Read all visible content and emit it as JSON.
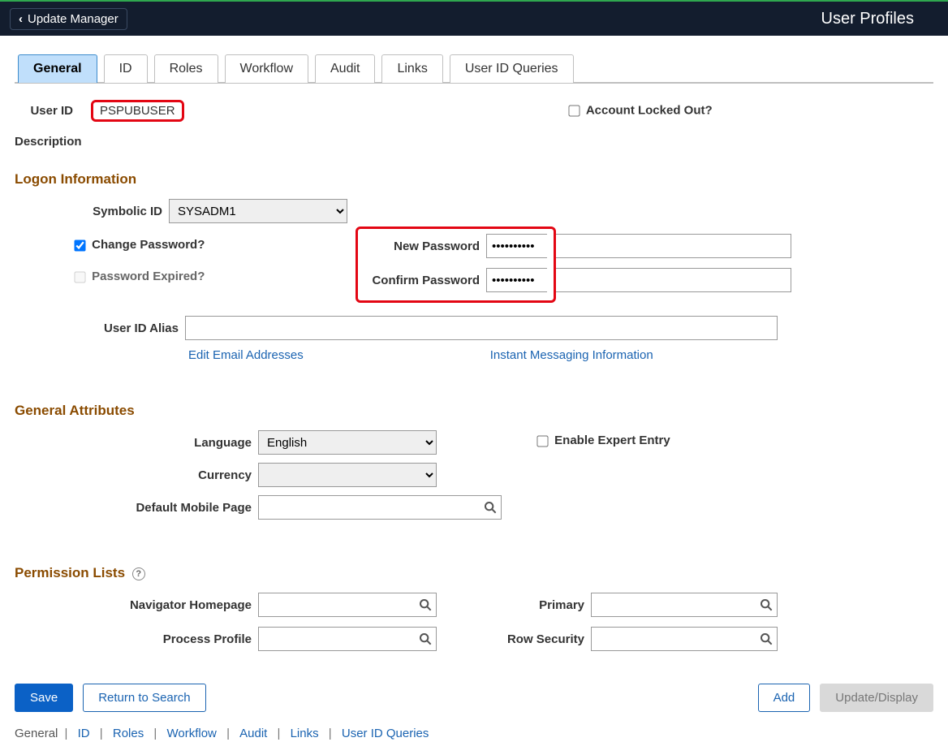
{
  "header": {
    "back_label": "Update Manager",
    "page_title": "User Profiles"
  },
  "tabs": [
    "General",
    "ID",
    "Roles",
    "Workflow",
    "Audit",
    "Links",
    "User ID Queries"
  ],
  "top": {
    "user_id_label": "User ID",
    "user_id_value": "PSPUBUSER",
    "description_label": "Description",
    "account_locked_label": "Account Locked Out?",
    "account_locked_checked": false
  },
  "logon": {
    "heading": "Logon Information",
    "symbolic_id_label": "Symbolic ID",
    "symbolic_id_value": "SYSADM1",
    "change_password_label": "Change Password?",
    "change_password_checked": true,
    "password_expired_label": "Password Expired?",
    "password_expired_checked": false,
    "new_password_label": "New Password",
    "new_password_value": "••••••••••",
    "confirm_password_label": "Confirm Password",
    "confirm_password_value": "••••••••••",
    "user_id_alias_label": "User ID Alias",
    "user_id_alias_value": "",
    "edit_email_link": "Edit Email Addresses",
    "instant_msg_link": "Instant Messaging Information"
  },
  "general_attrs": {
    "heading": "General Attributes",
    "language_label": "Language",
    "language_value": "English",
    "currency_label": "Currency",
    "currency_value": "",
    "default_mobile_label": "Default Mobile Page",
    "default_mobile_value": "",
    "enable_expert_label": "Enable Expert Entry",
    "enable_expert_checked": false
  },
  "permission_lists": {
    "heading": "Permission Lists",
    "nav_home_label": "Navigator Homepage",
    "process_profile_label": "Process Profile",
    "primary_label": "Primary",
    "row_security_label": "Row Security"
  },
  "buttons": {
    "save": "Save",
    "return_to_search": "Return to Search",
    "add": "Add",
    "update_display": "Update/Display"
  },
  "breadcrumb": [
    "General",
    "ID",
    "Roles",
    "Workflow",
    "Audit",
    "Links",
    "User ID Queries"
  ]
}
